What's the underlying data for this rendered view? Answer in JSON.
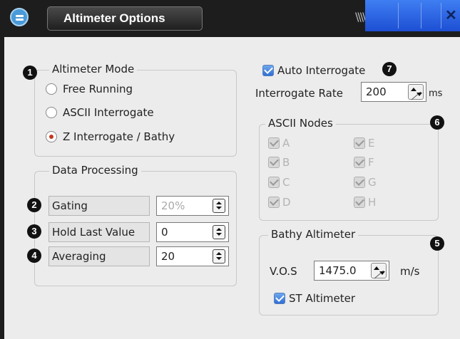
{
  "window": {
    "title": "Altimeter Options",
    "grip_glyph": "\\\\\\\\\\\\",
    "close_glyph": "✕"
  },
  "altimeter_mode": {
    "legend": "Altimeter Mode",
    "badge": "1",
    "options": [
      {
        "label": "Free Running",
        "selected": false
      },
      {
        "label": "ASCII Interrogate",
        "selected": false
      },
      {
        "label": "Z Interrogate / Bathy",
        "selected": true
      }
    ]
  },
  "data_processing": {
    "legend": "Data Processing",
    "rows": [
      {
        "badge": "2",
        "label": "Gating",
        "value": "20%",
        "disabled": true
      },
      {
        "badge": "3",
        "label": "Hold Last Value",
        "value": "0",
        "disabled": false
      },
      {
        "badge": "4",
        "label": "Averaging",
        "value": "20",
        "disabled": false
      }
    ]
  },
  "auto_interrogate": {
    "label": "Auto Interrogate",
    "checked": true,
    "badge": "7"
  },
  "interrogate_rate": {
    "label": "Interrogate Rate",
    "value": "200",
    "unit": "ms"
  },
  "ascii_nodes": {
    "legend": "ASCII Nodes",
    "badge": "6",
    "nodes": [
      "A",
      "B",
      "C",
      "D",
      "E",
      "F",
      "G",
      "H"
    ]
  },
  "bathy_altimeter": {
    "legend": "Bathy Altimeter",
    "badge": "5",
    "vos_label": "V.O.S",
    "vos_value": "1475.0",
    "vos_unit": "m/s",
    "st_altimeter_label": "ST Altimeter",
    "st_altimeter_checked": true
  },
  "colors": {
    "title_bar": "#1d1d1d",
    "accent_blue": "#2e6fd6",
    "panel_bg": "#ececec",
    "radio_selected": "#c4381f"
  }
}
